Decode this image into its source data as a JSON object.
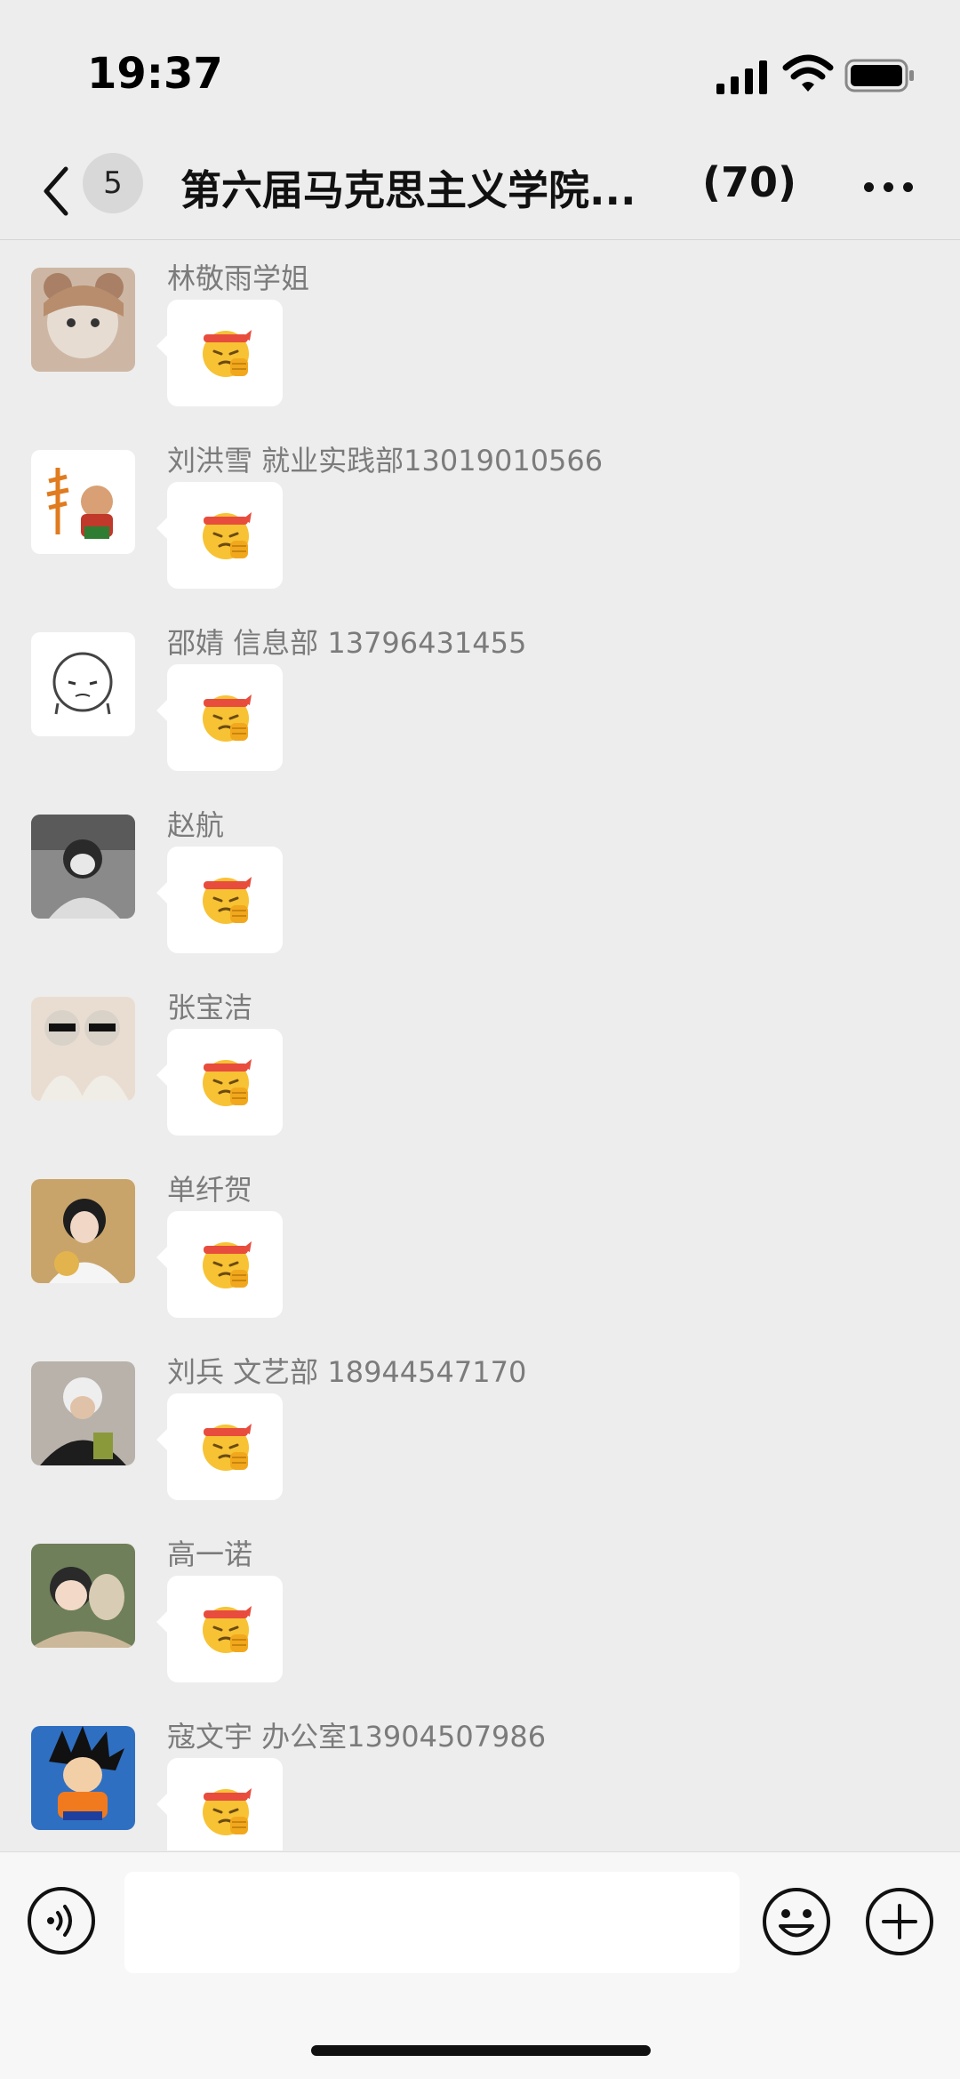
{
  "status_bar": {
    "time": "19:37"
  },
  "nav": {
    "back_icon": "chevron-left-icon",
    "unread_count": "5",
    "title": "第六届马克思主义学院...",
    "member_count": "(70)",
    "more_icon": "more-horizontal-icon"
  },
  "messages": [
    {
      "sender": "林敬雨学姐",
      "content": "fist-headband-emoji"
    },
    {
      "sender": "刘洪雪 就业实践部13019010566",
      "content": "fist-headband-emoji"
    },
    {
      "sender": "邵婧 信息部 13796431455",
      "content": "fist-headband-emoji"
    },
    {
      "sender": "赵航",
      "content": "fist-headband-emoji"
    },
    {
      "sender": "张宝洁",
      "content": "fist-headband-emoji"
    },
    {
      "sender": "单纤贺",
      "content": "fist-headband-emoji"
    },
    {
      "sender": "刘兵 文艺部 18944547170",
      "content": "fist-headband-emoji"
    },
    {
      "sender": "高一诺",
      "content": "fist-headband-emoji"
    },
    {
      "sender": "寇文宇 办公室13904507986",
      "content": "fist-headband-emoji"
    }
  ],
  "input_bar": {
    "voice_icon": "voice-icon",
    "text_value": "",
    "emoji_icon": "emoji-icon",
    "plus_icon": "plus-icon"
  },
  "colors": {
    "background": "#ededed",
    "bubble": "#ffffff",
    "sender_text": "#7b7b7b"
  }
}
